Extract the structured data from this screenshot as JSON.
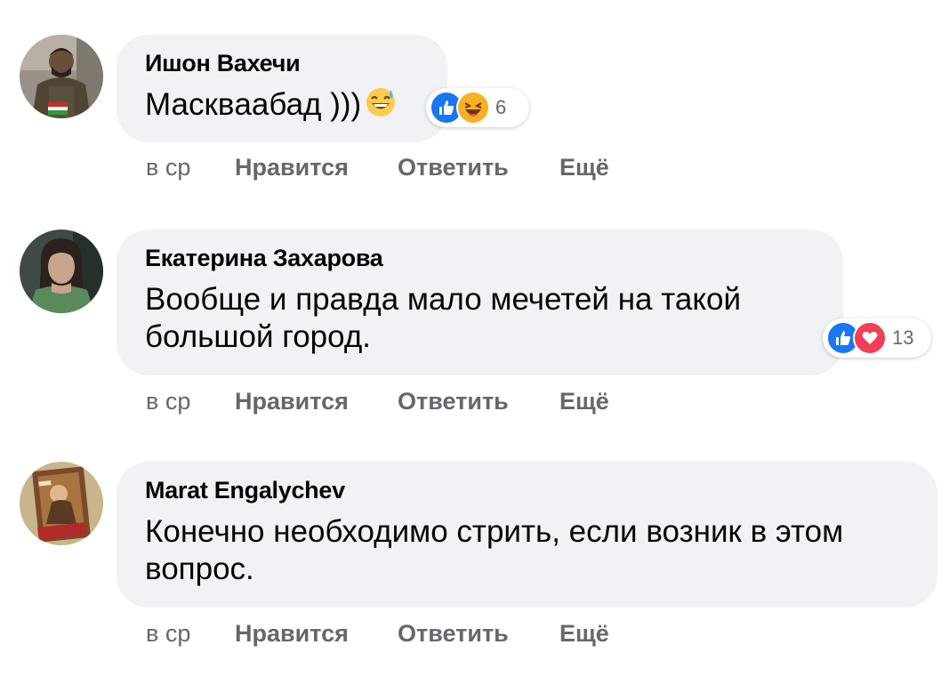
{
  "comments": [
    {
      "author": "Ишон Вахечи",
      "text": "Масквaабад )))",
      "inline_emoji": "grinning-sweat-emoji",
      "reactions": [
        "like",
        "haha"
      ],
      "reaction_count": "6",
      "actions": {
        "time": "в ср",
        "like": "Нравится",
        "reply": "Ответить",
        "more": "Ещё"
      }
    },
    {
      "author": "Екатерина Захарова",
      "text": "Вообще и правда мало мечетей на такой большой город.",
      "reactions": [
        "like",
        "love"
      ],
      "reaction_count": "13",
      "actions": {
        "time": "в ср",
        "like": "Нравится",
        "reply": "Ответить",
        "more": "Ещё"
      }
    },
    {
      "author": "Marat Engalychev",
      "text": "Конечно необходимо стрить, если возник в этом вопрос.",
      "actions": {
        "time": "в ср",
        "like": "Нравится",
        "reply": "Ответить",
        "more": "Ещё"
      }
    }
  ],
  "colors": {
    "bubble": "#f0f2f5",
    "secondary_text": "#65676b",
    "like_blue": "#1877f2",
    "love_red": "#f33e58",
    "haha_yellow": "#f7b125"
  }
}
